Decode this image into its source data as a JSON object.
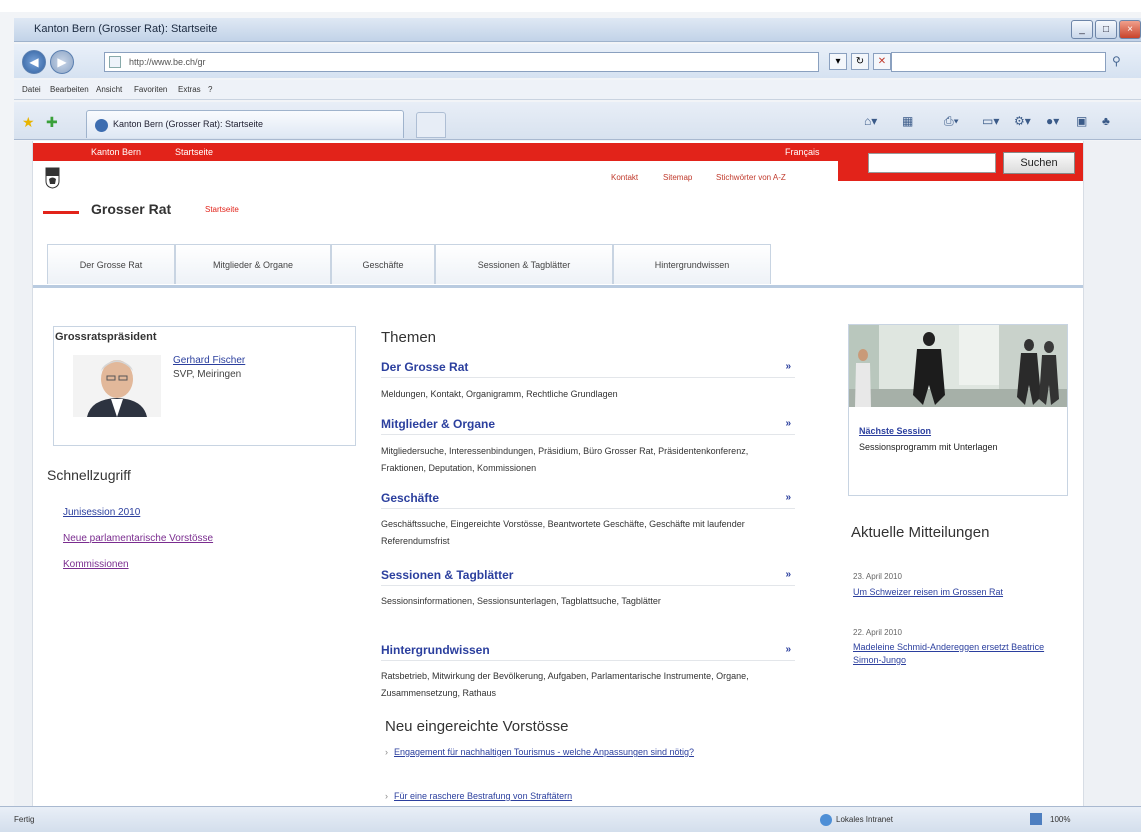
{
  "window": {
    "title": "Kanton Bern (Grosser Rat): Startseite",
    "controls": [
      "_",
      "□",
      "×"
    ]
  },
  "address_bar": {
    "url": "http://www.be.ch/gr"
  },
  "menu": [
    "Datei",
    "Bearbeiten",
    "Ansicht",
    "Favoriten",
    "Extras",
    "?"
  ],
  "tab": {
    "title": "Kanton Bern (Grosser Rat): Startseite"
  },
  "site": {
    "top_links": {
      "kanton": "Kanton Bern",
      "startseite": "Startseite",
      "francais": "Français"
    },
    "search_button": "Suchen",
    "util_links": [
      "Kontakt",
      "Sitemap",
      "Stichwörter von A-Z"
    ],
    "title": "Grosser Rat",
    "subtitle": "Startseite",
    "nav_tabs": [
      "Der Grosse Rat",
      "Mitglieder & Organe",
      "Geschäfte",
      "Sessionen & Tagblätter",
      "Hintergrundwissen"
    ]
  },
  "president": {
    "heading": "Grossratspräsident",
    "name": "Gerhard Fischer",
    "party": "SVP, Meiringen"
  },
  "quick_access": {
    "heading": "Schnellzugriff",
    "links": [
      "Junisession 2010",
      "Neue parlamentarische Vorstösse",
      "Kommissionen"
    ]
  },
  "themen": {
    "heading": "Themen",
    "arrow": "»",
    "items": [
      {
        "title": "Der Grosse Rat",
        "desc": "Meldungen, Kontakt, Organigramm, Rechtliche Grundlagen"
      },
      {
        "title": "Mitglieder & Organe",
        "desc": "Mitgliedersuche, Interessenbindungen, Präsidium, Büro Grosser Rat, Präsidentenkonferenz, Fraktionen, Deputation, Kommissionen"
      },
      {
        "title": "Geschäfte",
        "desc": "Geschäftssuche, Eingereichte Vorstösse, Beantwortete Geschäfte, Geschäfte mit laufender Referendumsfrist"
      },
      {
        "title": "Sessionen & Tagblätter",
        "desc": "Sessionsinformationen, Sessionsunterlagen, Tagblattsuche, Tagblätter"
      },
      {
        "title": "Hintergrundwissen",
        "desc": "Ratsbetrieb, Mitwirkung der Bevölkerung, Aufgaben, Parlamentarische Instrumente, Organe, Zusammensetzung, Rathaus"
      }
    ]
  },
  "neu": {
    "heading": "Neu eingereichte Vorstösse",
    "items": [
      "Engagement für nachhaltigen Tourismus - welche Anpassungen sind nötig?",
      "Für eine raschere Bestrafung von Straftätern"
    ]
  },
  "session_box": {
    "link": "Nächste Session",
    "desc": "Sessionsprogramm mit Unterlagen"
  },
  "mitteilungen": {
    "heading": "Aktuelle Mitteilungen",
    "items": [
      {
        "date": "23. April 2010",
        "title": "Um Schweizer reisen im Grossen Rat"
      },
      {
        "date": "22. April 2010",
        "title": "Madeleine Schmid-Andereggen ersetzt Beatrice Simon-Jungo"
      }
    ]
  },
  "status": {
    "text": "Fertig",
    "zone": "Lokales Intranet",
    "zoom": "100%"
  }
}
